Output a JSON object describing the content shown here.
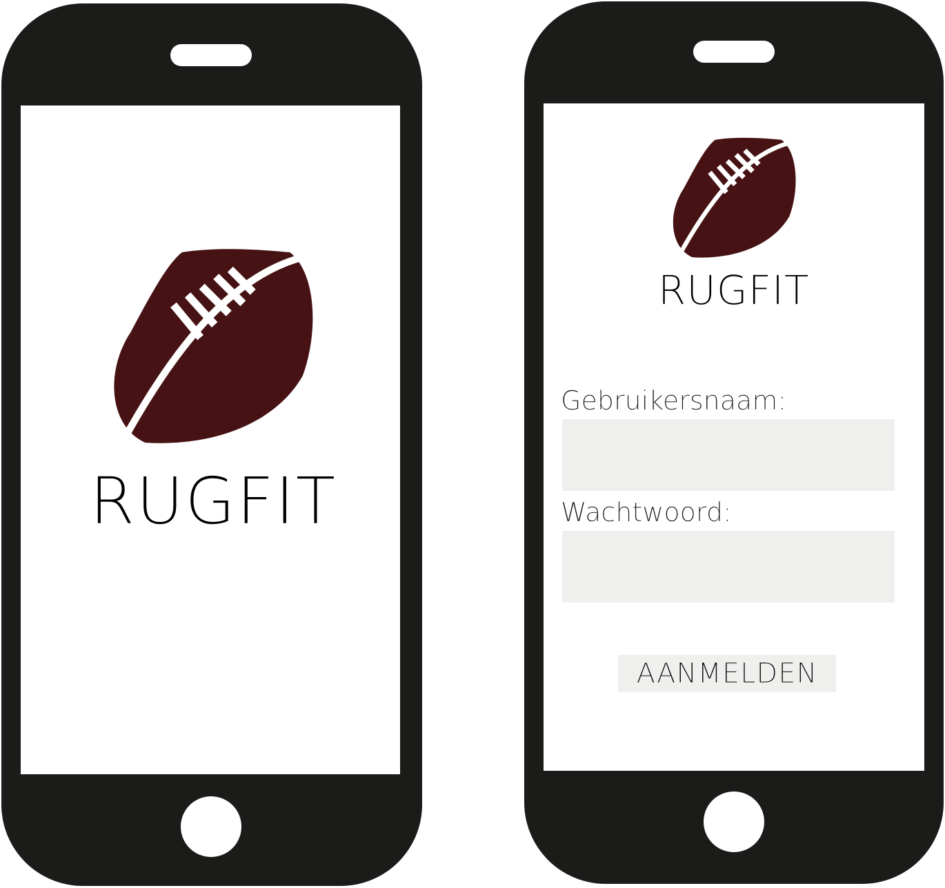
{
  "theme": {
    "phone_body": "#1b1b1a",
    "screen_bg": "#ffffff",
    "ball_color": "#461214",
    "input_bg": "#efefed"
  },
  "splash_screen": {
    "logo_icon": "rugby-ball-icon",
    "brand": "RUGFIT"
  },
  "login_screen": {
    "logo_icon": "rugby-ball-icon",
    "brand": "RUGFIT",
    "username_label": "Gebruikersnaam:",
    "username_value": "",
    "password_label": "Wachtwoord:",
    "password_value": "",
    "submit_label": "AANMELDEN"
  }
}
